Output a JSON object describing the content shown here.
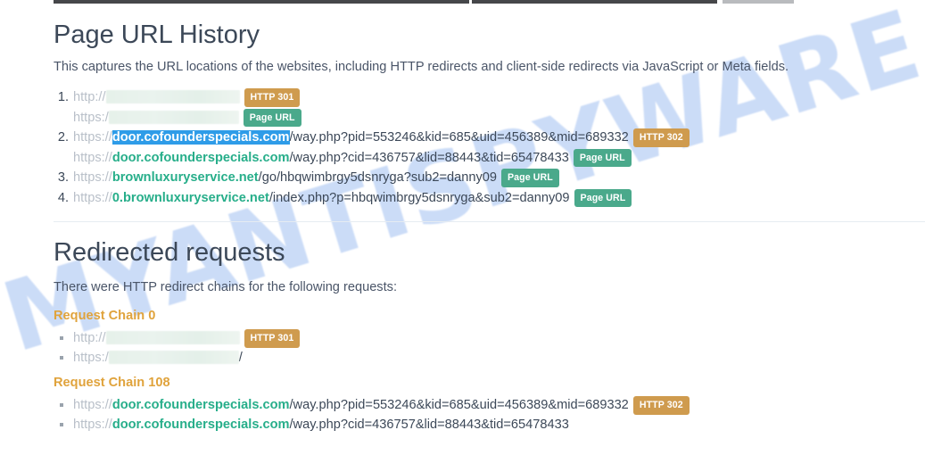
{
  "watermark": {
    "text": "MYANTISPYWARE.COM",
    "color": "#cbdcf7"
  },
  "colors": {
    "heading": "#3c4858",
    "host_green": "#27ae8a",
    "scheme_gray": "#b9c0c9",
    "badge_http": "#cf9b4e",
    "badge_pageurl": "#4aa98b",
    "selection_blue": "#2e9ce8",
    "chain_title_orange": "#e0a33c",
    "redaction": "#e6f1ea"
  },
  "url_history": {
    "title": "Page URL History",
    "description": "This captures the URL locations of the websites, including HTTP redirects and client-side redirects via JavaScript or Meta fields.",
    "items": [
      {
        "number": "1.",
        "lines": [
          {
            "scheme": "http://",
            "host": "",
            "path": "",
            "redacted": true,
            "redact_width": 150,
            "badge": "HTTP 301",
            "badge_type": "http",
            "selected": false
          },
          {
            "scheme": "https:/",
            "host": "",
            "path": "",
            "redacted": true,
            "redact_width": 146,
            "badge": "Page URL",
            "badge_type": "pageurl",
            "selected": false
          }
        ]
      },
      {
        "number": "2.",
        "lines": [
          {
            "scheme": "https://",
            "host": "door.cofounderspecials.com",
            "path": "/way.php?pid=553246&kid=685&uid=456389&mid=689332",
            "redacted": false,
            "badge": "HTTP 302",
            "badge_type": "http",
            "selected": true
          },
          {
            "scheme": "https://",
            "host": "door.cofounderspecials.com",
            "path": "/way.php?cid=436757&lid=88443&tid=65478433",
            "redacted": false,
            "badge": "Page URL",
            "badge_type": "pageurl",
            "selected": false
          }
        ]
      },
      {
        "number": "3.",
        "lines": [
          {
            "scheme": "https://",
            "host": "brownluxuryservice.net",
            "path": "/go/hbqwimbrgy5dsnryga?sub2=danny09",
            "redacted": false,
            "badge": "Page URL",
            "badge_type": "pageurl",
            "selected": false
          }
        ]
      },
      {
        "number": "4.",
        "lines": [
          {
            "scheme": "https://",
            "host": "0.brownluxuryservice.net",
            "path": "/index.php?p=hbqwimbrgy5dsnryga&sub2=danny09",
            "redacted": false,
            "badge": "Page URL",
            "badge_type": "pageurl",
            "selected": false
          }
        ]
      }
    ]
  },
  "redirected_requests": {
    "title": "Redirected requests",
    "description": "There were HTTP redirect chains for the following requests:",
    "chains": [
      {
        "title": "Request Chain 0",
        "entries": [
          {
            "scheme": "http://",
            "host": "",
            "path": "",
            "redacted": true,
            "redact_width": 150,
            "badge": "HTTP 301",
            "badge_type": "http",
            "trailing": ""
          },
          {
            "scheme": "https:/",
            "host": "",
            "path": "",
            "redacted": true,
            "redact_width": 146,
            "badge": "",
            "badge_type": "",
            "trailing": "/"
          }
        ]
      },
      {
        "title": "Request Chain 108",
        "entries": [
          {
            "scheme": "https://",
            "host": "door.cofounderspecials.com",
            "path": "/way.php?pid=553246&kid=685&uid=456389&mid=689332",
            "redacted": false,
            "badge": "HTTP 302",
            "badge_type": "http",
            "trailing": ""
          },
          {
            "scheme": "https://",
            "host": "door.cofounderspecials.com",
            "path": "/way.php?cid=436757&lid=88443&tid=65478433",
            "redacted": false,
            "badge": "",
            "badge_type": "",
            "trailing": ""
          }
        ]
      }
    ]
  }
}
